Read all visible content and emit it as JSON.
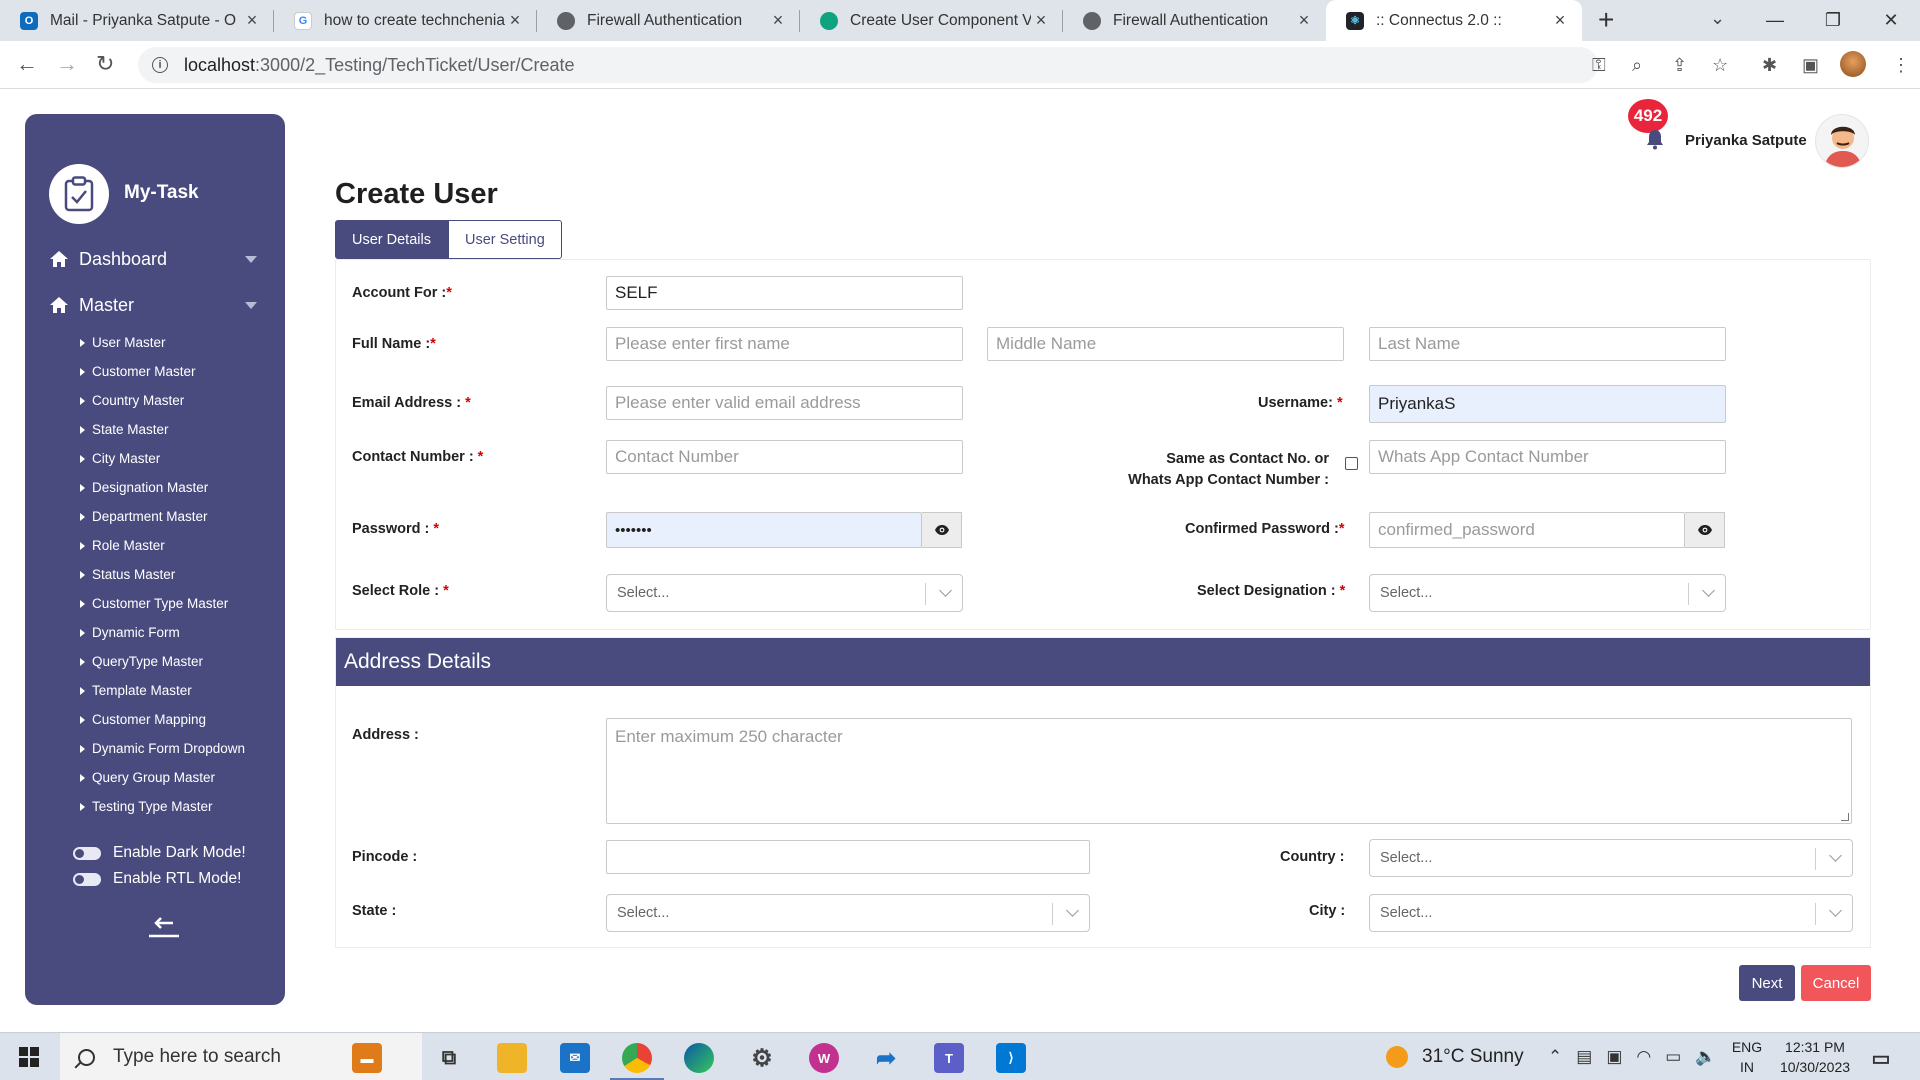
{
  "browser": {
    "tabs": [
      {
        "title": "Mail - Priyanka Satpute - O",
        "icon": "outlook-icon",
        "color": "#0f6cbd"
      },
      {
        "title": "how to create technchenia",
        "icon": "google-icon",
        "color": "#4285f4"
      },
      {
        "title": "Firewall Authentication",
        "icon": "globe-icon",
        "color": "#5f6368"
      },
      {
        "title": "Create User Component Va",
        "icon": "chatgpt-icon",
        "color": "#10a37f"
      },
      {
        "title": "Firewall Authentication",
        "icon": "globe-icon",
        "color": "#5f6368"
      },
      {
        "title": ":: Connectus 2.0 ::",
        "icon": "react-icon",
        "color": "#20232a"
      }
    ],
    "url_host": "localhost",
    "url_rest": ":3000/2_Testing/TechTicket/User/Create"
  },
  "sidebar": {
    "brand": "My-Task",
    "menu": [
      {
        "label": "Dashboard"
      },
      {
        "label": "Master"
      }
    ],
    "submenu": [
      "User Master",
      "Customer Master",
      "Country Master",
      "State Master",
      "City Master",
      "Designation Master",
      "Department Master",
      "Role Master",
      "Status Master",
      "Customer Type Master",
      "Dynamic Form",
      "QueryType Master",
      "Template Master",
      "Customer Mapping",
      "Dynamic Form Dropdown",
      "Query Group Master",
      "Testing Type Master"
    ],
    "dark_mode": "Enable Dark Mode!",
    "rtl_mode": "Enable RTL Mode!"
  },
  "header": {
    "notification_count": "492",
    "user_name": "Priyanka Satpute"
  },
  "page": {
    "title": "Create User",
    "tabs": [
      "User Details",
      "User Setting"
    ]
  },
  "form": {
    "account_for": {
      "label": "Account For :",
      "value": "SELF"
    },
    "full_name": {
      "label": "Full Name :",
      "first_ph": "Please enter first name",
      "middle_ph": "Middle Name",
      "last_ph": "Last Name"
    },
    "email": {
      "label": "Email Address : ",
      "placeholder": "Please enter valid email address"
    },
    "username": {
      "label": "Username: ",
      "value": "PriyankaS"
    },
    "contact": {
      "label": "Contact Number : ",
      "placeholder": "Contact Number"
    },
    "same_as_contact": {
      "line1": "Same as Contact No. or",
      "line2": "Whats App Contact Number :"
    },
    "whatsapp": {
      "placeholder": "Whats App Contact Number"
    },
    "password": {
      "label": "Password : ",
      "value": "•••••••"
    },
    "confirm_password": {
      "label": "Confirmed Password :",
      "placeholder": "confirmed_password"
    },
    "role": {
      "label": "Select Role : ",
      "placeholder": "Select..."
    },
    "designation": {
      "label": "Select Designation : ",
      "placeholder": "Select..."
    },
    "required_mark": "*"
  },
  "address": {
    "section_title": "Address Details",
    "address": {
      "label": "Address :",
      "placeholder": "Enter maximum 250 character"
    },
    "pincode": {
      "label": "Pincode :"
    },
    "country": {
      "label": "Country :",
      "placeholder": "Select..."
    },
    "state": {
      "label": "State :",
      "placeholder": "Select..."
    },
    "city": {
      "label": "City :",
      "placeholder": "Select..."
    }
  },
  "actions": {
    "next": "Next",
    "cancel": "Cancel"
  },
  "taskbar": {
    "search_placeholder": "Type here to search",
    "weather": "31°C  Sunny",
    "lang_top": "ENG",
    "lang_bottom": "IN",
    "time": "12:31 PM",
    "date": "10/30/2023"
  },
  "colors": {
    "primary": "#494b7f",
    "danger": "#f0565a",
    "badge": "#e8253b"
  }
}
